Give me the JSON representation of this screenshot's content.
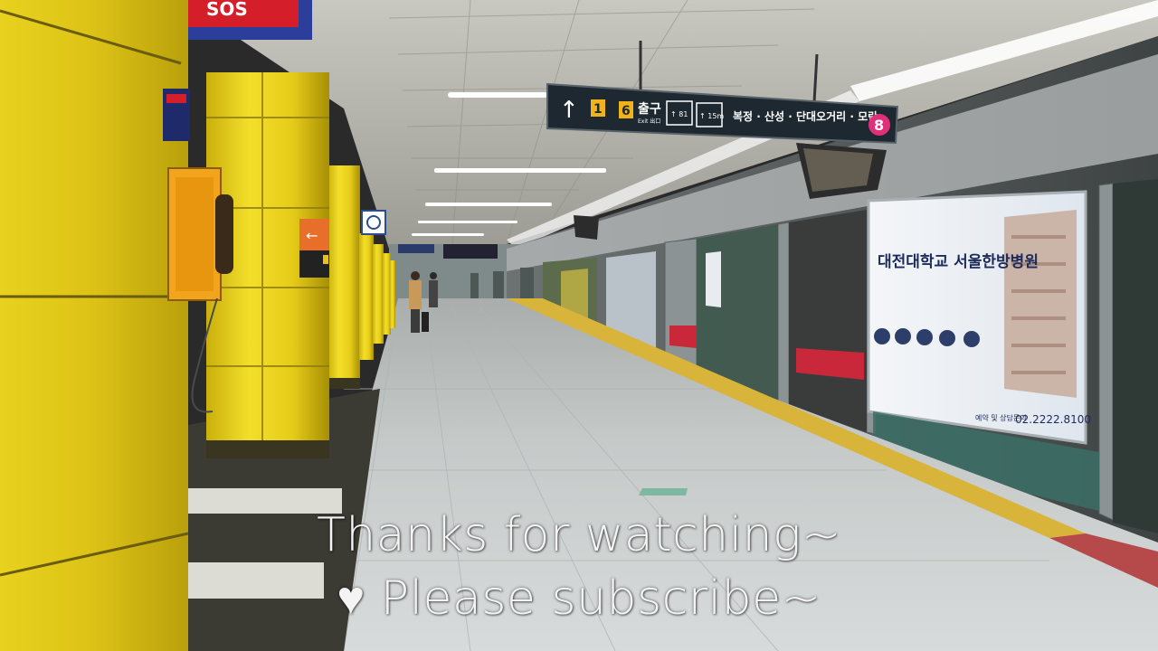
{
  "caption": {
    "line1": "Thanks for watching~",
    "heart": "♥",
    "line2": "Please subscribe~"
  },
  "signs": {
    "sos": "SOS",
    "exit_numbers": [
      "1",
      "6"
    ],
    "exit_label": "출구",
    "exit_sub": "Exit 出口",
    "elevator_note": "↑ 15m",
    "toilet_note": "↑ 81",
    "destinations": "복정 · 산성 · 단대오거리 · 모란",
    "line_number": "8",
    "platform_arrow": "←"
  },
  "ad": {
    "headline": "대전대학교 서울한방병원",
    "phone_prefix": "예약 및 상담문의",
    "phone": "02.2222.8100"
  },
  "colors": {
    "pillar_yellow": "#e6cf1a",
    "line8_pink": "#e0307a",
    "floor": "#cfd3d4",
    "tactile_yellow": "#d8b43a",
    "screen_door_frame": "#9aa2a4"
  }
}
